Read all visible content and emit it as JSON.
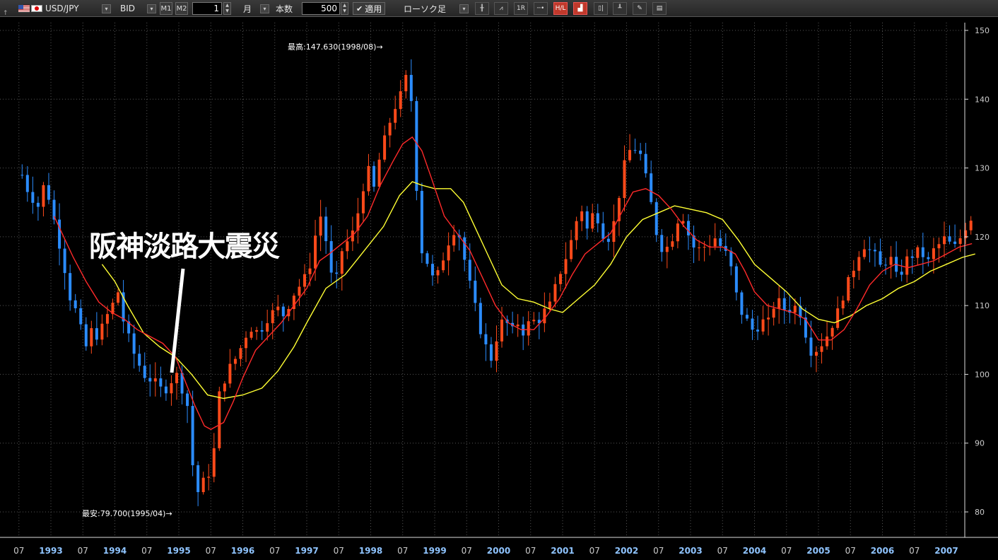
{
  "toolbar": {
    "pair": "USD/JPY",
    "price_type": "BID",
    "m1": "M1",
    "m2": "M2",
    "period_value": "1",
    "period_unit": "月",
    "count_label": "本数",
    "count_value": "500",
    "apply_label": "適用",
    "chart_type": "ローソク足",
    "icons": [
      "bar-chart-icon",
      "line-chart-icon",
      "1R",
      "line-icon",
      "high-low-icon",
      "volume-icon",
      "candle-icon",
      "indicator-icon",
      "draw-icon",
      "settings-icon"
    ],
    "button_1r": "1R"
  },
  "annotation": {
    "text": "阪神淡路大震災"
  },
  "chart_data": {
    "type": "candlestick",
    "title": "",
    "ylim": [
      77,
      151
    ],
    "yticks": [
      80,
      90,
      100,
      110,
      120,
      130,
      140,
      150
    ],
    "x_tick_labels": [
      "07",
      "1993",
      "07",
      "1994",
      "07",
      "1995",
      "07",
      "1996",
      "07",
      "1997",
      "07",
      "1998",
      "07",
      "1999",
      "07",
      "2000",
      "07",
      "2001",
      "07",
      "2002",
      "07",
      "2003",
      "07",
      "2004",
      "07",
      "2005",
      "07",
      "2006",
      "07",
      "2007"
    ],
    "max_label": "最高:147.630(1998/08)→",
    "min_label": "最安:79.700(1995/04)→",
    "colors": {
      "up": "#ff4a1a",
      "down": "#2b8cff",
      "ma_short": "#ff2a2a",
      "ma_long": "#ffff33",
      "grid": "#555555",
      "axis": "#dddddd"
    },
    "ma_short_label": "",
    "ma_long_label": "",
    "close_path": [
      [
        1992.55,
        129.0
      ],
      [
        1992.65,
        126.5
      ],
      [
        1992.8,
        124.5
      ],
      [
        1992.9,
        127.8
      ],
      [
        1993.0,
        124.8
      ],
      [
        1993.1,
        120.0
      ],
      [
        1993.2,
        117.0
      ],
      [
        1993.25,
        112.0
      ],
      [
        1993.35,
        110.5
      ],
      [
        1993.45,
        107.0
      ],
      [
        1993.55,
        104.0
      ],
      [
        1993.6,
        106.5
      ],
      [
        1993.75,
        105.5
      ],
      [
        1993.85,
        108.0
      ],
      [
        1993.95,
        109.8
      ],
      [
        1994.05,
        112.0
      ],
      [
        1994.15,
        107.0
      ],
      [
        1994.3,
        103.0
      ],
      [
        1994.45,
        100.0
      ],
      [
        1994.6,
        99.0
      ],
      [
        1994.75,
        97.5
      ],
      [
        1994.85,
        98.5
      ],
      [
        1994.9,
        99.5
      ],
      [
        1995.0,
        100.0
      ],
      [
        1995.05,
        98.0
      ],
      [
        1995.15,
        95.0
      ],
      [
        1995.2,
        88.0
      ],
      [
        1995.28,
        82.5
      ],
      [
        1995.35,
        84.0
      ],
      [
        1995.45,
        85.0
      ],
      [
        1995.55,
        89.0
      ],
      [
        1995.6,
        96.0
      ],
      [
        1995.7,
        99.0
      ],
      [
        1995.8,
        101.0
      ],
      [
        1995.9,
        102.5
      ],
      [
        1996.0,
        104.5
      ],
      [
        1996.1,
        107.0
      ],
      [
        1996.25,
        106.0
      ],
      [
        1996.4,
        108.5
      ],
      [
        1996.55,
        109.5
      ],
      [
        1996.65,
        108.5
      ],
      [
        1996.75,
        111.0
      ],
      [
        1996.85,
        112.5
      ],
      [
        1996.95,
        113.5
      ],
      [
        1997.05,
        116.0
      ],
      [
        1997.15,
        121.0
      ],
      [
        1997.25,
        124.0
      ],
      [
        1997.35,
        115.0
      ],
      [
        1997.45,
        113.0
      ],
      [
        1997.55,
        118.0
      ],
      [
        1997.65,
        119.5
      ],
      [
        1997.75,
        121.0
      ],
      [
        1997.85,
        126.0
      ],
      [
        1997.95,
        130.0
      ],
      [
        1998.05,
        127.0
      ],
      [
        1998.15,
        132.0
      ],
      [
        1998.25,
        135.0
      ],
      [
        1998.35,
        138.5
      ],
      [
        1998.45,
        140.0
      ],
      [
        1998.55,
        143.0
      ],
      [
        1998.6,
        147.6
      ],
      [
        1998.65,
        136.0
      ],
      [
        1998.75,
        123.0
      ],
      [
        1998.8,
        118.0
      ],
      [
        1998.9,
        116.0
      ],
      [
        1999.0,
        113.0
      ],
      [
        1999.1,
        116.0
      ],
      [
        1999.2,
        119.0
      ],
      [
        1999.3,
        121.0
      ],
      [
        1999.4,
        120.0
      ],
      [
        1999.5,
        115.0
      ],
      [
        1999.6,
        111.0
      ],
      [
        1999.7,
        107.0
      ],
      [
        1999.8,
        104.0
      ],
      [
        1999.9,
        102.0
      ],
      [
        2000.0,
        107.0
      ],
      [
        2000.1,
        108.0
      ],
      [
        2000.2,
        106.0
      ],
      [
        2000.3,
        107.5
      ],
      [
        2000.4,
        106.0
      ],
      [
        2000.5,
        108.0
      ],
      [
        2000.6,
        107.5
      ],
      [
        2000.7,
        109.0
      ],
      [
        2000.8,
        110.0
      ],
      [
        2000.9,
        113.0
      ],
      [
        2001.0,
        116.0
      ],
      [
        2001.1,
        118.0
      ],
      [
        2001.2,
        122.0
      ],
      [
        2001.3,
        124.0
      ],
      [
        2001.4,
        120.5
      ],
      [
        2001.5,
        124.5
      ],
      [
        2001.6,
        121.0
      ],
      [
        2001.7,
        119.5
      ],
      [
        2001.8,
        122.0
      ],
      [
        2001.9,
        127.0
      ],
      [
        2002.0,
        132.0
      ],
      [
        2002.1,
        133.0
      ],
      [
        2002.2,
        132.5
      ],
      [
        2002.3,
        128.5
      ],
      [
        2002.4,
        124.0
      ],
      [
        2002.5,
        119.0
      ],
      [
        2002.6,
        118.0
      ],
      [
        2002.7,
        119.5
      ],
      [
        2002.8,
        122.5
      ],
      [
        2002.9,
        123.0
      ],
      [
        2003.0,
        119.0
      ],
      [
        2003.1,
        118.0
      ],
      [
        2003.2,
        118.5
      ],
      [
        2003.3,
        119.0
      ],
      [
        2003.4,
        120.0
      ],
      [
        2003.5,
        118.0
      ],
      [
        2003.6,
        117.0
      ],
      [
        2003.7,
        112.0
      ],
      [
        2003.8,
        109.0
      ],
      [
        2003.9,
        107.5
      ],
      [
        2004.0,
        106.0
      ],
      [
        2004.1,
        108.0
      ],
      [
        2004.2,
        107.0
      ],
      [
        2004.3,
        110.0
      ],
      [
        2004.4,
        110.5
      ],
      [
        2004.5,
        109.0
      ],
      [
        2004.6,
        110.0
      ],
      [
        2004.7,
        109.5
      ],
      [
        2004.8,
        106.0
      ],
      [
        2004.9,
        103.0
      ],
      [
        2005.0,
        104.0
      ],
      [
        2005.1,
        105.0
      ],
      [
        2005.2,
        107.0
      ],
      [
        2005.3,
        109.0
      ],
      [
        2005.4,
        112.0
      ],
      [
        2005.5,
        114.0
      ],
      [
        2005.6,
        117.0
      ],
      [
        2005.7,
        119.0
      ],
      [
        2005.8,
        118.0
      ],
      [
        2005.9,
        117.0
      ],
      [
        2006.0,
        115.0
      ],
      [
        2006.1,
        118.0
      ],
      [
        2006.2,
        114.0
      ],
      [
        2006.3,
        115.0
      ],
      [
        2006.4,
        117.0
      ],
      [
        2006.5,
        117.5
      ],
      [
        2006.6,
        118.0
      ],
      [
        2006.7,
        116.0
      ],
      [
        2006.8,
        118.0
      ],
      [
        2006.9,
        119.0
      ],
      [
        2007.0,
        120.0
      ],
      [
        2007.1,
        118.0
      ],
      [
        2007.2,
        119.5
      ],
      [
        2007.3,
        121.5
      ],
      [
        2007.4,
        123.0
      ]
    ],
    "ma_short_path": [
      [
        1993.05,
        123.0
      ],
      [
        1993.2,
        120.0
      ],
      [
        1993.35,
        117.0
      ],
      [
        1993.55,
        113.5
      ],
      [
        1993.75,
        110.5
      ],
      [
        1993.95,
        109.0
      ],
      [
        1994.15,
        108.0
      ],
      [
        1994.35,
        106.5
      ],
      [
        1994.55,
        105.5
      ],
      [
        1994.75,
        104.5
      ],
      [
        1994.95,
        102.5
      ],
      [
        1995.1,
        99.0
      ],
      [
        1995.25,
        95.5
      ],
      [
        1995.4,
        92.5
      ],
      [
        1995.5,
        92.0
      ],
      [
        1995.7,
        93.0
      ],
      [
        1995.85,
        96.0
      ],
      [
        1996.0,
        99.5
      ],
      [
        1996.2,
        103.5
      ],
      [
        1996.4,
        105.5
      ],
      [
        1996.6,
        107.5
      ],
      [
        1996.8,
        110.0
      ],
      [
        1997.0,
        112.5
      ],
      [
        1997.2,
        116.5
      ],
      [
        1997.35,
        117.5
      ],
      [
        1997.55,
        119.0
      ],
      [
        1997.75,
        120.5
      ],
      [
        1997.95,
        123.0
      ],
      [
        1998.15,
        127.5
      ],
      [
        1998.35,
        131.0
      ],
      [
        1998.5,
        133.5
      ],
      [
        1998.65,
        134.5
      ],
      [
        1998.8,
        132.5
      ],
      [
        1998.95,
        128.5
      ],
      [
        1999.15,
        123.0
      ],
      [
        1999.35,
        120.5
      ],
      [
        1999.55,
        118.0
      ],
      [
        1999.75,
        114.0
      ],
      [
        1999.95,
        110.0
      ],
      [
        2000.15,
        107.5
      ],
      [
        2000.35,
        106.5
      ],
      [
        2000.55,
        106.5
      ],
      [
        2000.75,
        108.5
      ],
      [
        2000.95,
        111.0
      ],
      [
        2001.15,
        114.5
      ],
      [
        2001.35,
        117.5
      ],
      [
        2001.55,
        119.0
      ],
      [
        2001.75,
        120.5
      ],
      [
        2001.95,
        124.0
      ],
      [
        2002.1,
        126.5
      ],
      [
        2002.3,
        127.0
      ],
      [
        2002.5,
        126.0
      ],
      [
        2002.7,
        124.0
      ],
      [
        2002.9,
        121.5
      ],
      [
        2003.1,
        119.5
      ],
      [
        2003.3,
        118.5
      ],
      [
        2003.5,
        118.5
      ],
      [
        2003.7,
        117.5
      ],
      [
        2003.85,
        115.0
      ],
      [
        2004.0,
        112.0
      ],
      [
        2004.2,
        110.0
      ],
      [
        2004.4,
        109.5
      ],
      [
        2004.6,
        109.0
      ],
      [
        2004.8,
        108.0
      ],
      [
        2005.0,
        105.0
      ],
      [
        2005.2,
        105.0
      ],
      [
        2005.4,
        106.5
      ],
      [
        2005.6,
        109.5
      ],
      [
        2005.8,
        113.0
      ],
      [
        2006.0,
        115.0
      ],
      [
        2006.2,
        116.0
      ],
      [
        2006.4,
        115.5
      ],
      [
        2006.6,
        116.0
      ],
      [
        2006.8,
        116.5
      ],
      [
        2007.0,
        117.5
      ],
      [
        2007.2,
        118.5
      ],
      [
        2007.4,
        119.0
      ]
    ],
    "ma_long_path": [
      [
        1993.8,
        116.0
      ],
      [
        1994.0,
        113.5
      ],
      [
        1994.2,
        110.0
      ],
      [
        1994.45,
        106.0
      ],
      [
        1994.7,
        104.0
      ],
      [
        1994.95,
        102.5
      ],
      [
        1995.2,
        100.0
      ],
      [
        1995.45,
        97.0
      ],
      [
        1995.7,
        96.5
      ],
      [
        1996.0,
        97.0
      ],
      [
        1996.3,
        98.0
      ],
      [
        1996.55,
        100.5
      ],
      [
        1996.8,
        104.0
      ],
      [
        1997.0,
        107.5
      ],
      [
        1997.3,
        112.5
      ],
      [
        1997.6,
        114.5
      ],
      [
        1997.9,
        118.0
      ],
      [
        1998.2,
        121.5
      ],
      [
        1998.45,
        126.0
      ],
      [
        1998.65,
        128.0
      ],
      [
        1998.8,
        127.5
      ],
      [
        1999.0,
        127.0
      ],
      [
        1999.25,
        127.0
      ],
      [
        1999.45,
        125.0
      ],
      [
        1999.65,
        121.0
      ],
      [
        1999.85,
        117.0
      ],
      [
        2000.05,
        113.0
      ],
      [
        2000.3,
        111.0
      ],
      [
        2000.55,
        110.5
      ],
      [
        2000.8,
        109.5
      ],
      [
        2001.0,
        109.0
      ],
      [
        2001.25,
        111.0
      ],
      [
        2001.5,
        113.0
      ],
      [
        2001.75,
        116.0
      ],
      [
        2002.0,
        120.0
      ],
      [
        2002.25,
        122.5
      ],
      [
        2002.5,
        123.5
      ],
      [
        2002.75,
        124.5
      ],
      [
        2003.0,
        124.0
      ],
      [
        2003.25,
        123.5
      ],
      [
        2003.5,
        122.5
      ],
      [
        2003.75,
        119.5
      ],
      [
        2004.0,
        116.0
      ],
      [
        2004.25,
        114.0
      ],
      [
        2004.5,
        112.0
      ],
      [
        2004.75,
        109.5
      ],
      [
        2005.0,
        108.0
      ],
      [
        2005.25,
        107.5
      ],
      [
        2005.5,
        108.5
      ],
      [
        2005.75,
        110.0
      ],
      [
        2006.0,
        111.0
      ],
      [
        2006.25,
        112.5
      ],
      [
        2006.5,
        113.5
      ],
      [
        2006.75,
        115.0
      ],
      [
        2007.0,
        116.0
      ],
      [
        2007.25,
        117.0
      ],
      [
        2007.45,
        117.5
      ]
    ]
  }
}
